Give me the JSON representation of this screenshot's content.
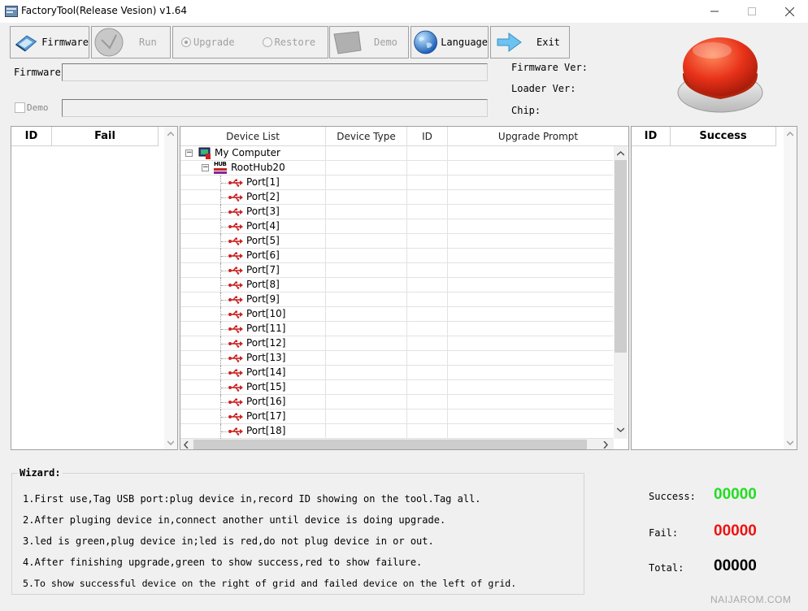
{
  "window": {
    "title": "FactoryTool(Release Vesion) v1.64"
  },
  "toolbar": {
    "firmware": "Firmware",
    "run": "Run",
    "upgrade": "Upgrade",
    "restore": "Restore",
    "demo": "Demo",
    "language": "Language",
    "exit": "Exit"
  },
  "fields": {
    "firmware_label": "Firmware",
    "demo_label": "Demo",
    "firmware_ver_label": "Firmware Ver:",
    "loader_ver_label": "Loader Ver:",
    "chip_label": "Chip:"
  },
  "fail_panel": {
    "col_id": "ID",
    "col_fail": "Fail"
  },
  "success_panel": {
    "col_id": "ID",
    "col_success": "Success"
  },
  "device_grid": {
    "columns": [
      "Device List",
      "Device Type",
      "ID",
      "Upgrade Prompt"
    ],
    "root": "My Computer",
    "hub": "RootHub20",
    "hub_badge": "HUB",
    "ports": [
      "Port[1]",
      "Port[2]",
      "Port[3]",
      "Port[4]",
      "Port[5]",
      "Port[6]",
      "Port[7]",
      "Port[8]",
      "Port[9]",
      "Port[10]",
      "Port[11]",
      "Port[12]",
      "Port[13]",
      "Port[14]",
      "Port[15]",
      "Port[16]",
      "Port[17]",
      "Port[18]"
    ]
  },
  "wizard": {
    "title": "Wizard:",
    "lines": [
      "1.First use,Tag USB port:plug device in,record ID showing on the tool.Tag all.",
      "2.After pluging device in,connect another until device is doing upgrade.",
      "3.led is green,plug device in;led is red,do not plug device in or out.",
      "4.After finishing upgrade,green to show success,red to show failure.",
      "5.To show successful device on the right of grid and failed device on the left of grid."
    ]
  },
  "stats": {
    "success_label": "Success:",
    "success_value": "00000",
    "fail_label": "Fail:",
    "fail_value": "00000",
    "total_label": "Total:",
    "total_value": "00000"
  },
  "colors": {
    "success": "#22dd22",
    "fail": "#ee1111",
    "total": "#000000",
    "status_led": "#e8321a"
  },
  "watermark": "NAIJAROM.COM"
}
